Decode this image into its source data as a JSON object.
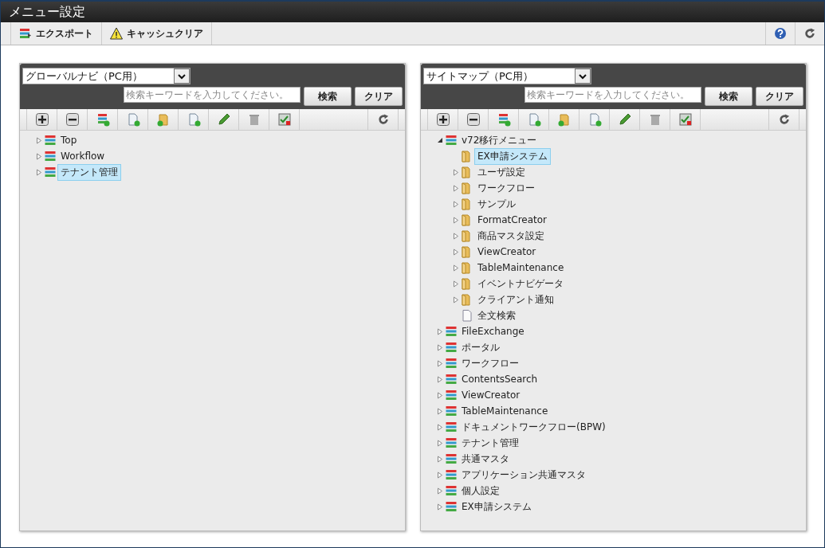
{
  "window": {
    "title": "メニュー設定"
  },
  "toolbar": {
    "buttons": [
      {
        "kind": "export",
        "label": "エクスポート"
      },
      {
        "kind": "warning",
        "label": "キャッシュクリア"
      }
    ]
  },
  "panels": [
    {
      "select": {
        "value": "グローバルナビ（PC用）"
      },
      "search": {
        "placeholder": "検索キーワードを入力してください。"
      },
      "buttons": [
        "検索",
        "クリア"
      ],
      "tree": [
        {
          "kind": "menu",
          "label": "Top",
          "expanded": false,
          "selected": false
        },
        {
          "kind": "menu",
          "label": "Workflow",
          "expanded": false,
          "selected": false
        },
        {
          "kind": "menu",
          "label": "テナント管理",
          "expanded": false,
          "selected": true
        }
      ]
    },
    {
      "select": {
        "value": "サイトマップ（PC用）"
      },
      "search": {
        "placeholder": "検索キーワードを入力してください。"
      },
      "buttons": [
        "検索",
        "クリア"
      ],
      "tree": [
        {
          "kind": "menu",
          "label": "v72移行メニュー",
          "expanded": true,
          "selected": false,
          "children": [
            {
              "kind": "folder",
              "label": "EX申請システム",
              "selected": true
            },
            {
              "kind": "folder",
              "label": "ユーザ設定",
              "expanded": false,
              "selected": false
            },
            {
              "kind": "folder",
              "label": "ワークフロー",
              "expanded": false,
              "selected": false
            },
            {
              "kind": "folder",
              "label": "サンプル",
              "expanded": false,
              "selected": false
            },
            {
              "kind": "folder",
              "label": "FormatCreator",
              "expanded": false,
              "selected": false
            },
            {
              "kind": "folder",
              "label": "商品マスタ設定",
              "expanded": false,
              "selected": false
            },
            {
              "kind": "folder",
              "label": "ViewCreator",
              "expanded": false,
              "selected": false
            },
            {
              "kind": "folder",
              "label": "TableMaintenance",
              "expanded": false,
              "selected": false
            },
            {
              "kind": "folder",
              "label": "イベントナビゲータ",
              "expanded": false,
              "selected": false
            },
            {
              "kind": "folder",
              "label": "クライアント通知",
              "expanded": false,
              "selected": false
            },
            {
              "kind": "page",
              "label": "全文検索",
              "selected": false
            }
          ]
        },
        {
          "kind": "menu",
          "label": "FileExchange",
          "expanded": false,
          "selected": false
        },
        {
          "kind": "menu",
          "label": "ポータル",
          "expanded": false,
          "selected": false
        },
        {
          "kind": "menu",
          "label": "ワークフロー",
          "expanded": false,
          "selected": false
        },
        {
          "kind": "menu",
          "label": "ContentsSearch",
          "expanded": false,
          "selected": false
        },
        {
          "kind": "menu",
          "label": "ViewCreator",
          "expanded": false,
          "selected": false
        },
        {
          "kind": "menu",
          "label": "TableMaintenance",
          "expanded": false,
          "selected": false
        },
        {
          "kind": "menu",
          "label": "ドキュメントワークフロー(BPW)",
          "expanded": false,
          "selected": false
        },
        {
          "kind": "menu",
          "label": "テナント管理",
          "expanded": false,
          "selected": false
        },
        {
          "kind": "menu",
          "label": "共通マスタ",
          "expanded": false,
          "selected": false
        },
        {
          "kind": "menu",
          "label": "アプリケーション共通マスタ",
          "expanded": false,
          "selected": false
        },
        {
          "kind": "menu",
          "label": "個人設定",
          "expanded": false,
          "selected": false
        },
        {
          "kind": "menu",
          "label": "EX申請システム",
          "expanded": false,
          "selected": false
        }
      ]
    }
  ]
}
